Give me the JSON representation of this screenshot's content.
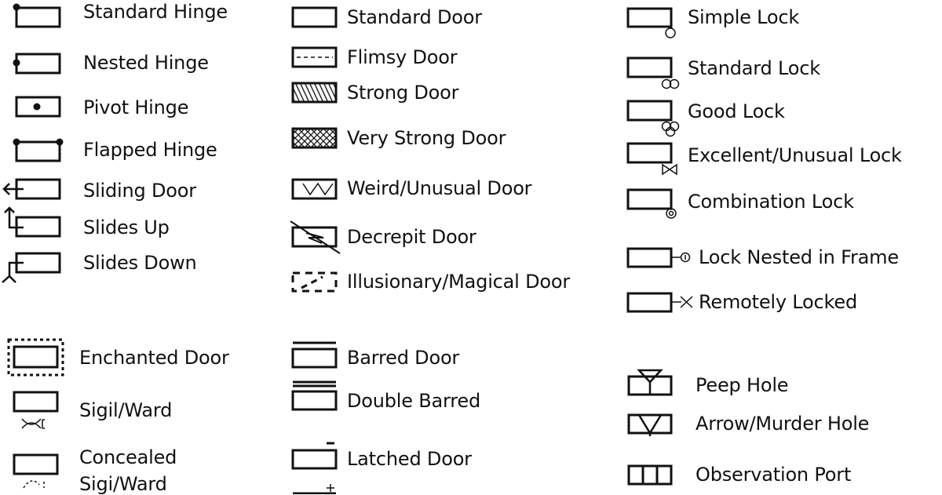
{
  "legend": {
    "hinges": [
      {
        "label": "Standard Hinge",
        "icon": "standard-hinge-symbol"
      },
      {
        "label": "Nested Hinge",
        "icon": "nested-hinge-symbol"
      },
      {
        "label": "Pivot Hinge",
        "icon": "pivot-hinge-symbol"
      },
      {
        "label": "Flapped Hinge",
        "icon": "flapped-hinge-symbol"
      },
      {
        "label": "Sliding Door",
        "icon": "sliding-door-symbol"
      },
      {
        "label": "Slides Up",
        "icon": "slides-up-symbol"
      },
      {
        "label": "Slides Down",
        "icon": "slides-down-symbol"
      }
    ],
    "magic": [
      {
        "label": "Enchanted Door",
        "icon": "enchanted-door-symbol"
      },
      {
        "label": "Sigil/Ward",
        "icon": "sigil-ward-symbol"
      },
      {
        "label": "Concealed",
        "label2": "Sigi/Ward",
        "icon": "concealed-sigil-symbol"
      }
    ],
    "doors": [
      {
        "label": "Standard Door",
        "icon": "standard-door-symbol"
      },
      {
        "label": "Flimsy Door",
        "icon": "flimsy-door-symbol"
      },
      {
        "label": "Strong Door",
        "icon": "strong-door-symbol"
      },
      {
        "label": "Very Strong Door",
        "icon": "very-strong-door-symbol"
      },
      {
        "label": "Weird/Unusual Door",
        "icon": "weird-door-symbol"
      },
      {
        "label": "Decrepit Door",
        "icon": "decrepit-door-symbol"
      },
      {
        "label": "Illusionary/Magical Door",
        "icon": "illusionary-door-symbol"
      }
    ],
    "bars": [
      {
        "label": "Barred Door",
        "icon": "barred-door-symbol"
      },
      {
        "label": "Double Barred",
        "icon": "double-barred-symbol"
      },
      {
        "label": "Latched Door",
        "icon": "latched-door-symbol"
      }
    ],
    "locks": [
      {
        "label": "Simple Lock",
        "icon": "simple-lock-symbol"
      },
      {
        "label": "Standard Lock",
        "icon": "standard-lock-symbol"
      },
      {
        "label": "Good Lock",
        "icon": "good-lock-symbol"
      },
      {
        "label": "Excellent/Unusual Lock",
        "icon": "excellent-lock-symbol"
      },
      {
        "label": "Combination Lock",
        "icon": "combination-lock-symbol"
      },
      {
        "label": "Lock Nested in Frame",
        "icon": "nested-lock-symbol"
      },
      {
        "label": "Remotely Locked",
        "icon": "remote-lock-symbol"
      }
    ],
    "holes": [
      {
        "label": "Peep Hole",
        "icon": "peep-hole-symbol"
      },
      {
        "label": "Arrow/Murder Hole",
        "icon": "murder-hole-symbol"
      },
      {
        "label": "Observation Port",
        "icon": "observation-port-symbol"
      }
    ]
  }
}
